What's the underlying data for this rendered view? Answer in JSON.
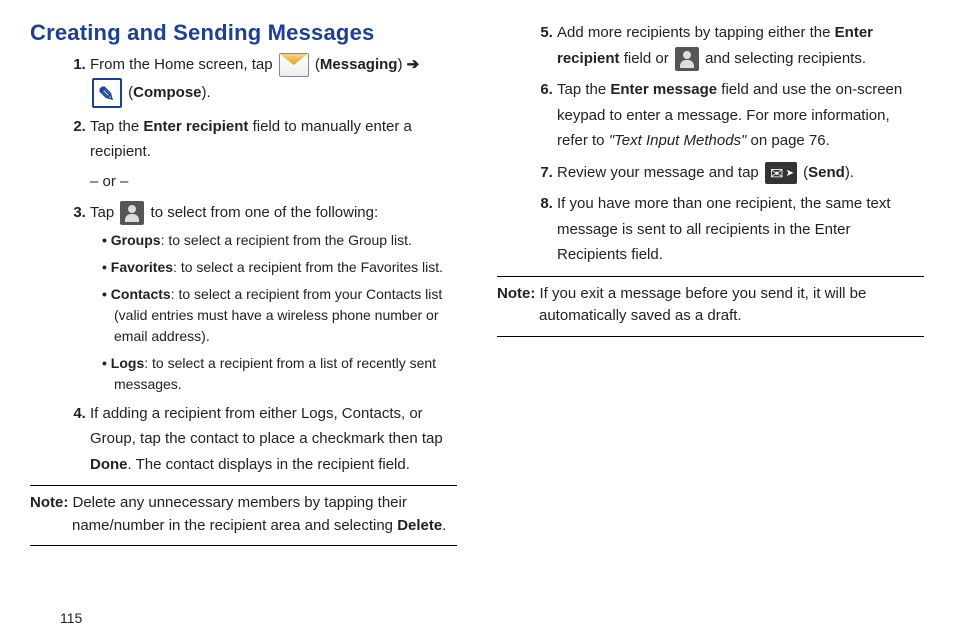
{
  "title": "Creating and Sending Messages",
  "col1": {
    "step1_a": "From the Home screen, tap ",
    "step1_b": " (",
    "step1_c": "Messaging",
    "step1_d": ") ",
    "step1_arrow": "➔",
    "step1_e": " (",
    "step1_f": "Compose",
    "step1_g": ").",
    "step2_a": "Tap the ",
    "step2_b": "Enter recipient",
    "step2_c": " field to manually enter a recipient.",
    "step2_or": "– or –",
    "step3_a": "Tap ",
    "step3_b": " to select from one of the following:",
    "sub1_a": "Groups",
    "sub1_b": ": to select a recipient from the Group list.",
    "sub2_a": "Favorites",
    "sub2_b": ": to select a recipient from the Favorites list.",
    "sub3_a": "Contacts",
    "sub3_b": ": to select a recipient from your Contacts list (valid entries must have a wireless phone number or email address).",
    "sub4_a": "Logs",
    "sub4_b": ": to select a recipient from a list of recently sent messages.",
    "step4_a": "If adding a recipient from either Logs, Contacts, or Group, tap the contact to place a checkmark then tap ",
    "step4_b": "Done",
    "step4_c": ". The contact displays in the recipient field.",
    "note1_label": "Note:",
    "note1_a": " Delete any unnecessary members by tapping their name/number in the recipient area and selecting ",
    "note1_b": "Delete",
    "note1_c": "."
  },
  "col2": {
    "step5_a": "Add more recipients by tapping either the ",
    "step5_b": "Enter recipient",
    "step5_c": " field or ",
    "step5_d": " and selecting recipients.",
    "step6_a": "Tap the ",
    "step6_b": "Enter message",
    "step6_c": " field and use the on-screen keypad to enter a message. For more information, refer to ",
    "step6_d": "\"Text Input Methods\"",
    "step6_e": "  on page 76.",
    "step7_a": "Review your message and tap ",
    "step7_b": " (",
    "step7_c": "Send",
    "step7_d": ").",
    "step8_a": "If you have more than one recipient, the same text message is sent to all recipients in the Enter Recipients field.",
    "note2_label": "Note:",
    "note2_a": " If you exit a message before you send it, it will be automatically saved as a draft."
  },
  "pagenum": "115"
}
